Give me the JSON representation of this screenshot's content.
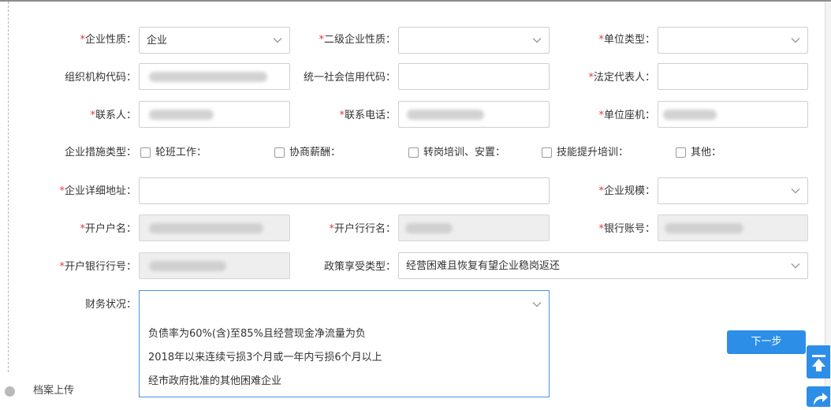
{
  "form": {
    "required_mark": "*",
    "row1": {
      "enterprise_nature_label": "企业性质：",
      "enterprise_nature_value": "企业",
      "secondary_nature_label": "二级企业性质：",
      "unit_type_label": "单位类型："
    },
    "row2": {
      "org_code_label": "组织机构代码：",
      "credit_code_label": "统一社会信用代码：",
      "legal_rep_label": "法定代表人："
    },
    "row3": {
      "contact_label": "联系人：",
      "phone_label": "联系电话：",
      "landline_label": "单位座机："
    },
    "measures": {
      "label": "企业措施类型：",
      "options": [
        "轮班工作：",
        "协商薪酬：",
        "转岗培训、安置：",
        "技能提升培训：",
        "其他："
      ]
    },
    "row5": {
      "address_label": "企业详细地址：",
      "scale_label": "企业规模："
    },
    "row6": {
      "account_name_label": "开户户名：",
      "bank_name_label": "开户行行名：",
      "account_no_label": "银行账号："
    },
    "row7": {
      "bank_code_label": "开户银行行号：",
      "policy_type_label": "政策享受类型：",
      "policy_type_value": "经营困难且恢复有望企业稳岗返还"
    },
    "finance": {
      "label": "财务状况：",
      "options": [
        "负债率为60%(含)至85%且经营现金净流量为负",
        "2018年以来连续亏损3个月或一年内亏损6个月以上",
        "经市政府批准的其他困难企业"
      ]
    }
  },
  "actions": {
    "next_label": "下一步"
  },
  "footer": {
    "upload_label": "档案上传"
  },
  "colors": {
    "accent": "#2d8ee8",
    "required": "#e03b3b",
    "focus_border": "#4a90e2"
  }
}
